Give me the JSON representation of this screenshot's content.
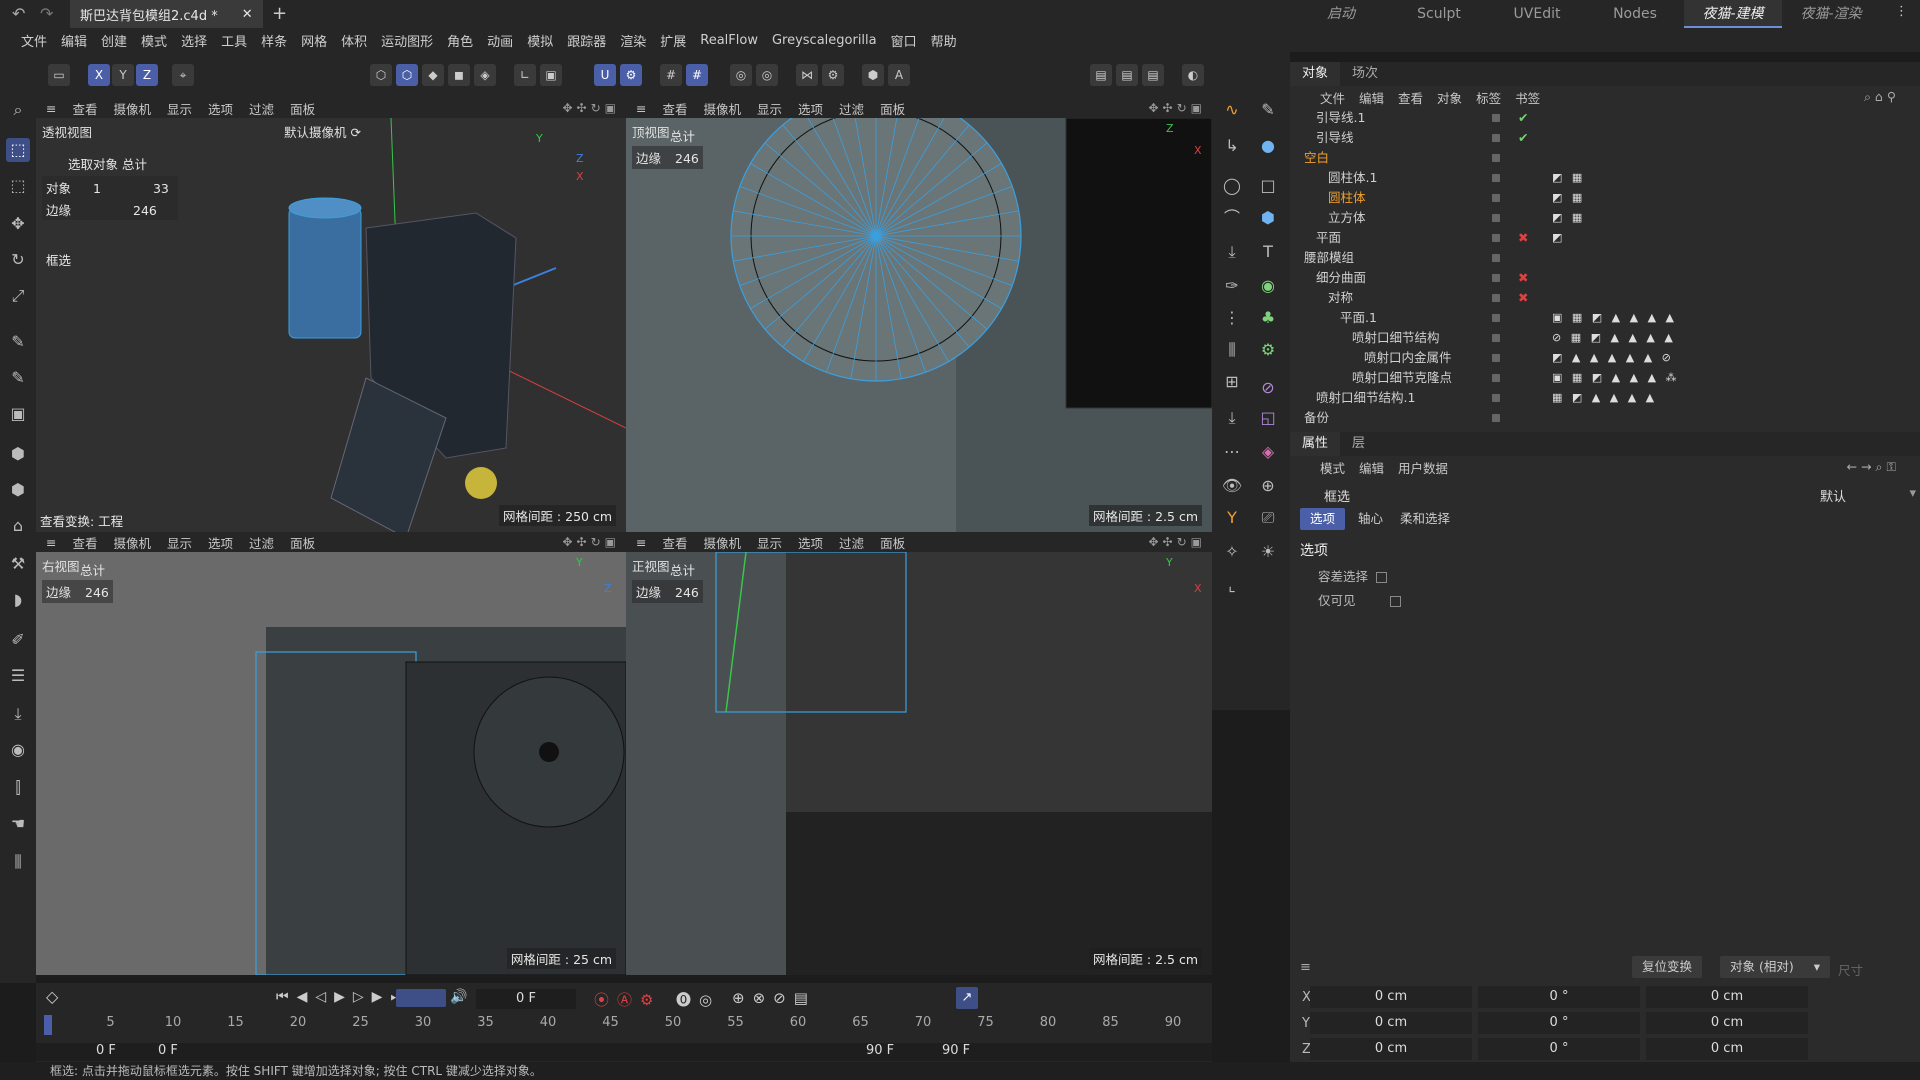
{
  "titlebar": {
    "doc_tab": "斯巴达背包模组2.c4d *",
    "workspaces": [
      "启动",
      "Sculpt",
      "UVEdit",
      "Nodes",
      "夜猫-建模",
      "夜猫-渲染"
    ],
    "active_workspace": "夜猫-建模"
  },
  "menu": [
    "文件",
    "编辑",
    "创建",
    "模式",
    "选择",
    "工具",
    "样条",
    "网格",
    "体积",
    "运动图形",
    "角色",
    "动画",
    "模拟",
    "跟踪器",
    "渲染",
    "扩展",
    "RealFlow",
    "Greyscalegorilla",
    "窗口",
    "帮助"
  ],
  "viewport_menu": [
    "查看",
    "摄像机",
    "显示",
    "选项",
    "过滤",
    "面板"
  ],
  "viewports": {
    "perspective": {
      "name": "透视视图",
      "camera": "默认摄像机 ⟳",
      "info_header": "选取对象 总计",
      "objects_label": "对象",
      "objects_sel": "1",
      "objects_total": "33",
      "edges_label": "边缘",
      "edges_total": "246",
      "mode": "框选",
      "transform": "查看变换: 工程",
      "grid": "网格间距 : 250 cm"
    },
    "top": {
      "name": "顶视图",
      "total": "总计",
      "edges_label": "边缘",
      "edges": "246",
      "grid": "网格间距 : 2.5 cm"
    },
    "right": {
      "name": "右视图",
      "total": "总计",
      "edges_label": "边缘",
      "edges": "246",
      "grid": "网格间距 : 25 cm"
    },
    "front": {
      "name": "正视图",
      "total": "总计",
      "edges_label": "边缘",
      "edges": "246",
      "grid": "网格间距 : 2.5 cm"
    }
  },
  "object_panel": {
    "tabs": [
      "对象",
      "场次"
    ],
    "menu": [
      "文件",
      "编辑",
      "查看",
      "对象",
      "标签",
      "书签"
    ],
    "rows": [
      {
        "name": "引导线.1",
        "indent": 1,
        "check": "✔",
        "tags": ""
      },
      {
        "name": "引导线",
        "indent": 1,
        "check": "✔",
        "tags": ""
      },
      {
        "name": "空白",
        "indent": 0,
        "orange": true,
        "check": "",
        "tags": ""
      },
      {
        "name": "圆柱体.1",
        "indent": 2,
        "check": "",
        "tags": "◩ ▦"
      },
      {
        "name": "圆柱体",
        "indent": 2,
        "orange": true,
        "check": "",
        "tags": "◩ ▦"
      },
      {
        "name": "立方体",
        "indent": 2,
        "check": "",
        "tags": "◩ ▦"
      },
      {
        "name": "平面",
        "indent": 1,
        "check": "✖",
        "tags": "◩"
      },
      {
        "name": "腰部模组",
        "indent": 0,
        "check": "",
        "tags": ""
      },
      {
        "name": "细分曲面",
        "indent": 1,
        "check": "✖",
        "tags": ""
      },
      {
        "name": "对称",
        "indent": 2,
        "check": "✖",
        "tags": ""
      },
      {
        "name": "平面.1",
        "indent": 3,
        "check": "",
        "tags": "▣ ▦ ◩ ▲ ▲ ▲ ▲"
      },
      {
        "name": "喷射口细节结构",
        "indent": 4,
        "check": "",
        "tags": "⊘ ▦ ◩ ▲ ▲ ▲ ▲"
      },
      {
        "name": "喷射口内金属件",
        "indent": 5,
        "check": "",
        "tags": "◩ ▲ ▲ ▲ ▲ ▲ ⊘"
      },
      {
        "name": "喷射口细节克隆点",
        "indent": 4,
        "check": "",
        "tags": "▣ ▦ ◩ ▲ ▲ ▲ ⁂"
      },
      {
        "name": "喷射口细节结构.1",
        "indent": 1,
        "check": "",
        "tags": "▦ ◩ ▲ ▲ ▲ ▲"
      },
      {
        "name": "备份",
        "indent": 0,
        "check": "",
        "tags": ""
      }
    ]
  },
  "attr_panel": {
    "tabs": [
      "属性",
      "层"
    ],
    "menu": [
      "模式",
      "编辑",
      "用户数据"
    ],
    "tool_name": "框选",
    "preset": "默认",
    "subtabs": [
      "选项",
      "轴心",
      "柔和选择"
    ],
    "section": "选项",
    "option1": "容差选择",
    "option2": "仅可见"
  },
  "coords": {
    "reset_btn": "复位变换",
    "mode": "对象 (相对)",
    "size_label": "尺寸",
    "rows": [
      {
        "axis": "X",
        "pos": "0 cm",
        "rot": "0 °",
        "size": "0 cm"
      },
      {
        "axis": "Y",
        "pos": "0 cm",
        "rot": "0 °",
        "size": "0 cm"
      },
      {
        "axis": "Z",
        "pos": "0 cm",
        "rot": "0 °",
        "size": "0 cm"
      }
    ]
  },
  "timeline": {
    "current_frame": "0 F",
    "start": "0 F",
    "start2": "0 F",
    "end": "90 F",
    "end2": "90 F",
    "ticks": [
      "0",
      "5",
      "10",
      "15",
      "20",
      "25",
      "30",
      "35",
      "40",
      "45",
      "50",
      "55",
      "60",
      "65",
      "70",
      "75",
      "80",
      "85",
      "90"
    ]
  },
  "status": "框选: 点击并拖动鼠标框选元素。按住 SHIFT 键增加选择对象; 按住 CTRL 键减少选择对象。",
  "colors": {
    "accent": "#4a5fa8",
    "orange": "#f0a030",
    "wire_blue": "#3aa0e0"
  }
}
